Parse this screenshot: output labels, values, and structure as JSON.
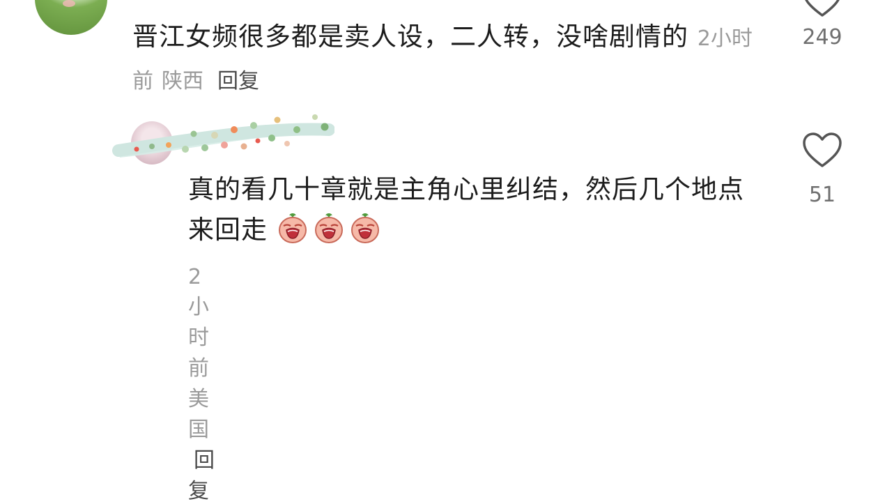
{
  "comments": [
    {
      "text": "晋江女频很多都是卖人设，二人转，没啥剧情的",
      "time": "2小时前",
      "location": "陕西",
      "reply_label": "回复",
      "likes": "249"
    },
    {
      "text": "真的看几十章就是主角心里纠结，然后几个地点来回走",
      "emojis": [
        "crying-face-emoji",
        "crying-face-emoji",
        "crying-face-emoji"
      ],
      "time": "2小时前",
      "location": "美国",
      "reply_label": "回复",
      "likes": "51"
    }
  ],
  "colors": {
    "text": "#1c1c1c",
    "meta": "#9a9a9a",
    "reply": "#4a4a4a",
    "like_count": "#6f6f6f"
  }
}
